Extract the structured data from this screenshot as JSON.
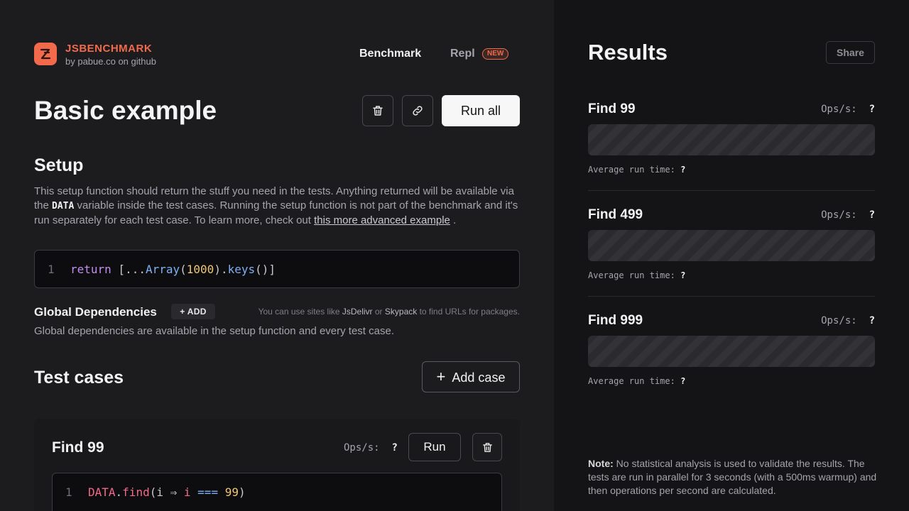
{
  "brand": {
    "name": "JSBENCHMARK",
    "sub": "by pabue.co on github"
  },
  "nav": {
    "benchmark": "Benchmark",
    "repl": "Repl",
    "repl_badge": "NEW"
  },
  "page": {
    "title": "Basic example",
    "run_all": "Run all"
  },
  "setup": {
    "heading": "Setup",
    "desc_1": "This setup function should return the stuff you need in the tests. Anything returned will be available via the ",
    "desc_code": "DATA",
    "desc_2": " variable inside the test cases. Running the setup function is not part of the benchmark and it's run separately for each test case. To learn more, check out ",
    "desc_link": "this more advanced example",
    "desc_3": " .",
    "code_line_number": "1",
    "code": {
      "kw": "return",
      "open": " [...",
      "fn1": "Array",
      "p1": "(",
      "num": "1000",
      "p2": ").",
      "fn2": "keys",
      "close": "()]"
    }
  },
  "dependencies": {
    "title": "Global Dependencies",
    "add_label": "ADD",
    "hint_1": "You can use sites like ",
    "hint_site1": "JsDelivr",
    "hint_2": " or ",
    "hint_site2": "Skypack",
    "hint_3": " to find URLs for packages.",
    "desc": "Global dependencies are available in the setup function and every test case."
  },
  "test_cases": {
    "heading": "Test cases",
    "add_label": "Add case",
    "items": [
      {
        "name": "Find 99",
        "ops_label": "Ops/s:",
        "ops_value": "?",
        "run_label": "Run",
        "line_number": "1",
        "code": {
          "data": "DATA",
          "dot": ".",
          "fn": "find",
          "p1": "(i ",
          "arrow": "⇒",
          "sp": " ",
          "var": "i",
          "sp2": " ",
          "eq": "===",
          "sp3": " ",
          "num": "99",
          "p2": ")"
        }
      }
    ]
  },
  "results": {
    "title": "Results",
    "share_label": "Share",
    "items": [
      {
        "name": "Find 99",
        "ops_label": "Ops/s:",
        "ops_value": "?",
        "avg_label": "Average run time:",
        "avg_value": "?"
      },
      {
        "name": "Find 499",
        "ops_label": "Ops/s:",
        "ops_value": "?",
        "avg_label": "Average run time:",
        "avg_value": "?"
      },
      {
        "name": "Find 999",
        "ops_label": "Ops/s:",
        "ops_value": "?",
        "avg_label": "Average run time:",
        "avg_value": "?"
      }
    ],
    "note_label": "Note:",
    "note_text": " No statistical analysis is used to validate the results. The tests are run in parallel for 3 seconds (with a 500ms warmup) and then operations per second are calculated."
  },
  "colors": {
    "accent": "#f26a4b",
    "background": "#1c1c1f",
    "panel": "#141416"
  }
}
